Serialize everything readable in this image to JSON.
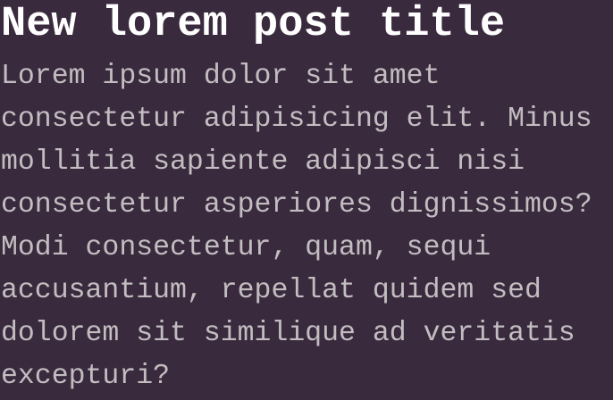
{
  "post": {
    "title": "New lorem post title",
    "body_lines": [
      "Lorem ipsum dolor sit amet",
      "consectetur adipisicing elit. Minus",
      "mollitia sapiente adipisci nisi",
      "consectetur asperiores dignissimos?",
      "Modi consectetur, quam, sequi",
      "accusantium, repellat quidem sed",
      "dolorem sit similique ad veritatis",
      "excepturi?"
    ]
  },
  "colors": {
    "background": "#3a2a3d",
    "title": "#ffffff",
    "body_text": "#c2bdc1"
  }
}
